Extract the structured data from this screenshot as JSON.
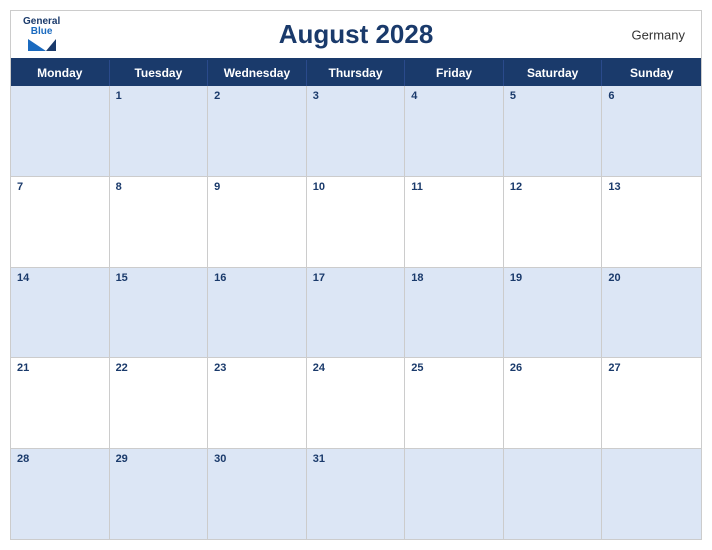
{
  "header": {
    "month_year": "August 2028",
    "country": "Germany",
    "logo": {
      "line1": "General",
      "line2": "Blue"
    }
  },
  "days_of_week": [
    "Monday",
    "Tuesday",
    "Wednesday",
    "Thursday",
    "Friday",
    "Saturday",
    "Sunday"
  ],
  "weeks": [
    [
      {
        "num": "",
        "shade": true
      },
      {
        "num": "1",
        "shade": true
      },
      {
        "num": "2",
        "shade": true
      },
      {
        "num": "3",
        "shade": true
      },
      {
        "num": "4",
        "shade": true
      },
      {
        "num": "5",
        "shade": true
      },
      {
        "num": "6",
        "shade": true
      }
    ],
    [
      {
        "num": "7",
        "shade": false
      },
      {
        "num": "8",
        "shade": false
      },
      {
        "num": "9",
        "shade": false
      },
      {
        "num": "10",
        "shade": false
      },
      {
        "num": "11",
        "shade": false
      },
      {
        "num": "12",
        "shade": false
      },
      {
        "num": "13",
        "shade": false
      }
    ],
    [
      {
        "num": "14",
        "shade": true
      },
      {
        "num": "15",
        "shade": true
      },
      {
        "num": "16",
        "shade": true
      },
      {
        "num": "17",
        "shade": true
      },
      {
        "num": "18",
        "shade": true
      },
      {
        "num": "19",
        "shade": true
      },
      {
        "num": "20",
        "shade": true
      }
    ],
    [
      {
        "num": "21",
        "shade": false
      },
      {
        "num": "22",
        "shade": false
      },
      {
        "num": "23",
        "shade": false
      },
      {
        "num": "24",
        "shade": false
      },
      {
        "num": "25",
        "shade": false
      },
      {
        "num": "26",
        "shade": false
      },
      {
        "num": "27",
        "shade": false
      }
    ],
    [
      {
        "num": "28",
        "shade": true
      },
      {
        "num": "29",
        "shade": true
      },
      {
        "num": "30",
        "shade": true
      },
      {
        "num": "31",
        "shade": true
      },
      {
        "num": "",
        "shade": true
      },
      {
        "num": "",
        "shade": true
      },
      {
        "num": "",
        "shade": true
      }
    ]
  ]
}
